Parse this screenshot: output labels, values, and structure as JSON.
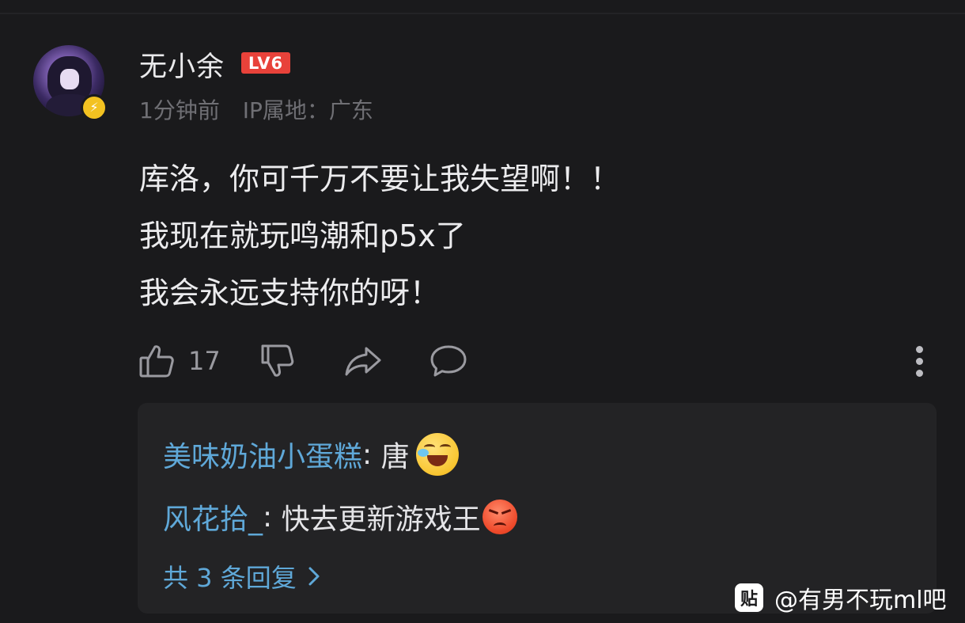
{
  "comment": {
    "username": "无小余",
    "level": "LV6",
    "time": "1分钟前",
    "ip_location": "IP属地：广东",
    "content_lines": [
      "库洛，你可千万不要让我失望啊！！",
      "我现在就玩鸣潮和p5x了",
      "我会永远支持你的呀！"
    ],
    "actions": {
      "like_count": "17",
      "like_icon": "thumbs-up-icon",
      "dislike_icon": "thumbs-down-icon",
      "share_icon": "share-icon",
      "reply_icon": "comment-bubble-icon",
      "more_icon": "more-vertical-icon"
    }
  },
  "replies": {
    "items": [
      {
        "author": "美味奶油小蛋糕",
        "separator": ": ",
        "text": "唐",
        "emoji": "laughing-crying-emoji"
      },
      {
        "author": "风花拾_",
        "separator": ": ",
        "text": "快去更新游戏王",
        "emoji": "angry-face-emoji"
      }
    ],
    "total_label": "共 3 条回复"
  },
  "watermark": {
    "logo_char": "贴",
    "text": "@有男不玩ml吧"
  },
  "colors": {
    "background": "#1a1a1c",
    "reply_box": "#232325",
    "link_blue": "#5fa8d8",
    "level_red": "#e8423a",
    "verified_yellow": "#f3c221",
    "muted_text": "#6f6f74"
  }
}
